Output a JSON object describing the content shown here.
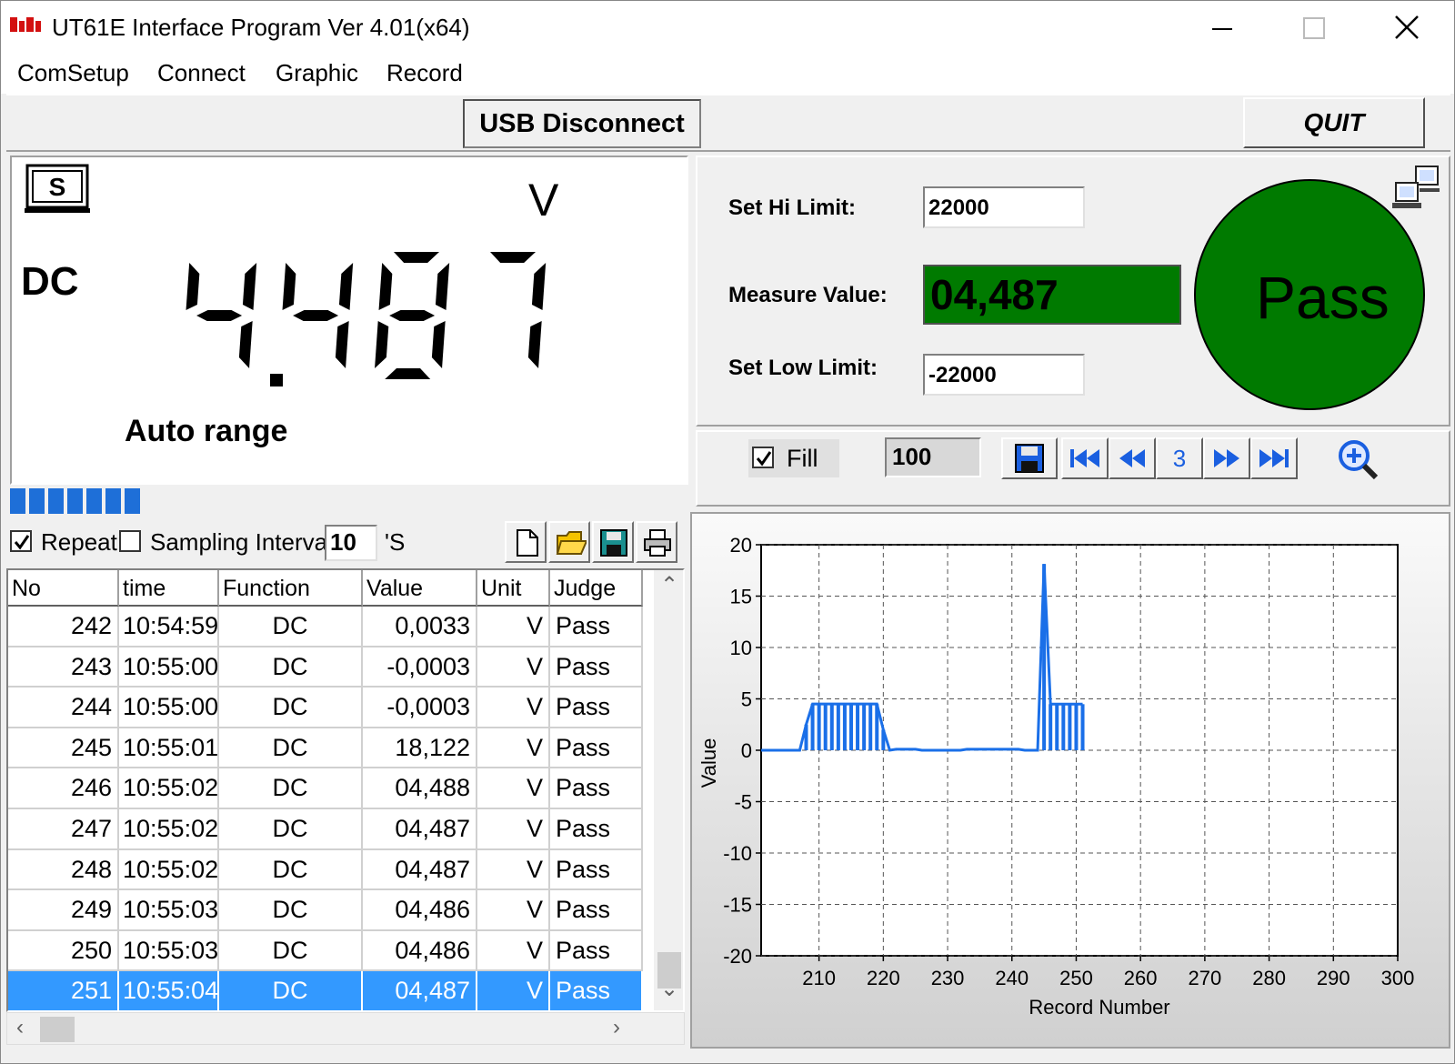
{
  "window": {
    "title": "UT61E Interface Program Ver 4.01(x64)",
    "colors": {
      "logo": "#d31010",
      "pass_green": "#007a00",
      "accent_blue": "#1a5fe0",
      "selection": "#3399ff"
    }
  },
  "menu": [
    "ComSetup",
    "Connect",
    "Graphic",
    "Record"
  ],
  "toolbar": {
    "usb_label": "USB Disconnect",
    "quit_label": "QUIT"
  },
  "display": {
    "s_label": "S",
    "unit": "V",
    "function": "DC",
    "reading": "4.487",
    "range": "Auto range",
    "bargraph_segments": 7
  },
  "limits": {
    "hi_label": "Set Hi Limit:",
    "hi_value": "22000",
    "measure_label": "Measure Value:",
    "measure_value": "04,487",
    "low_label": "Set Low Limit:",
    "low_value": "-22000",
    "verdict": "Pass"
  },
  "chart_toolbar": {
    "fill_label": "Fill",
    "fill_checked": true,
    "points": "100",
    "page": "3"
  },
  "controls": {
    "repeat_label": "Repeat",
    "repeat_checked": true,
    "interval_label": "Sampling Interval",
    "interval_checked": false,
    "interval_value": "10",
    "interval_unit": "'S"
  },
  "table": {
    "columns": [
      "No",
      "time",
      "Function",
      "Value",
      "Unit",
      "Judge"
    ],
    "rows": [
      [
        "242",
        "10:54:59",
        "DC",
        "0,0033",
        "V",
        "Pass"
      ],
      [
        "243",
        "10:55:00",
        "DC",
        "-0,0003",
        "V",
        "Pass"
      ],
      [
        "244",
        "10:55:00",
        "DC",
        "-0,0003",
        "V",
        "Pass"
      ],
      [
        "245",
        "10:55:01",
        "DC",
        "18,122",
        "V",
        "Pass"
      ],
      [
        "246",
        "10:55:02",
        "DC",
        "04,488",
        "V",
        "Pass"
      ],
      [
        "247",
        "10:55:02",
        "DC",
        "04,487",
        "V",
        "Pass"
      ],
      [
        "248",
        "10:55:02",
        "DC",
        "04,487",
        "V",
        "Pass"
      ],
      [
        "249",
        "10:55:03",
        "DC",
        "04,486",
        "V",
        "Pass"
      ],
      [
        "250",
        "10:55:03",
        "DC",
        "04,486",
        "V",
        "Pass"
      ],
      [
        "251",
        "10:55:04",
        "DC",
        "04,487",
        "V",
        "Pass"
      ]
    ],
    "selected_row": 9
  },
  "chart_data": {
    "type": "area",
    "xlabel": "Record Number",
    "ylabel": "Value",
    "xlim": [
      201,
      300
    ],
    "ylim": [
      -20,
      20
    ],
    "xticks": [
      210,
      220,
      230,
      240,
      250,
      260,
      270,
      280,
      290,
      300
    ],
    "yticks": [
      20,
      15,
      10,
      5,
      0,
      -5,
      -10,
      -15,
      -20
    ],
    "grid": true,
    "fill": true,
    "series": [
      {
        "color": "#1a6fe8",
        "x": [
          201,
          202,
          203,
          204,
          205,
          206,
          207,
          208,
          209,
          210,
          211,
          212,
          213,
          214,
          215,
          216,
          217,
          218,
          219,
          220,
          221,
          222,
          223,
          224,
          225,
          226,
          227,
          228,
          229,
          230,
          231,
          232,
          233,
          234,
          235,
          236,
          237,
          238,
          239,
          240,
          241,
          242,
          243,
          244,
          245,
          246,
          247,
          248,
          249,
          250,
          251
        ],
        "y": [
          0,
          0,
          0,
          0,
          0,
          0,
          0,
          2.5,
          4.5,
          4.5,
          4.5,
          4.5,
          4.5,
          4.5,
          4.5,
          4.5,
          4.5,
          4.5,
          4.5,
          2.0,
          0,
          0.1,
          0.1,
          0.1,
          0.1,
          0,
          0,
          0,
          0,
          0,
          0,
          0,
          0.1,
          0.1,
          0.1,
          0.1,
          0.1,
          0.1,
          0.1,
          0.1,
          0.1,
          0.0033,
          -0.0003,
          -0.0003,
          18.122,
          4.488,
          4.487,
          4.487,
          4.486,
          4.486,
          4.487
        ]
      }
    ]
  }
}
